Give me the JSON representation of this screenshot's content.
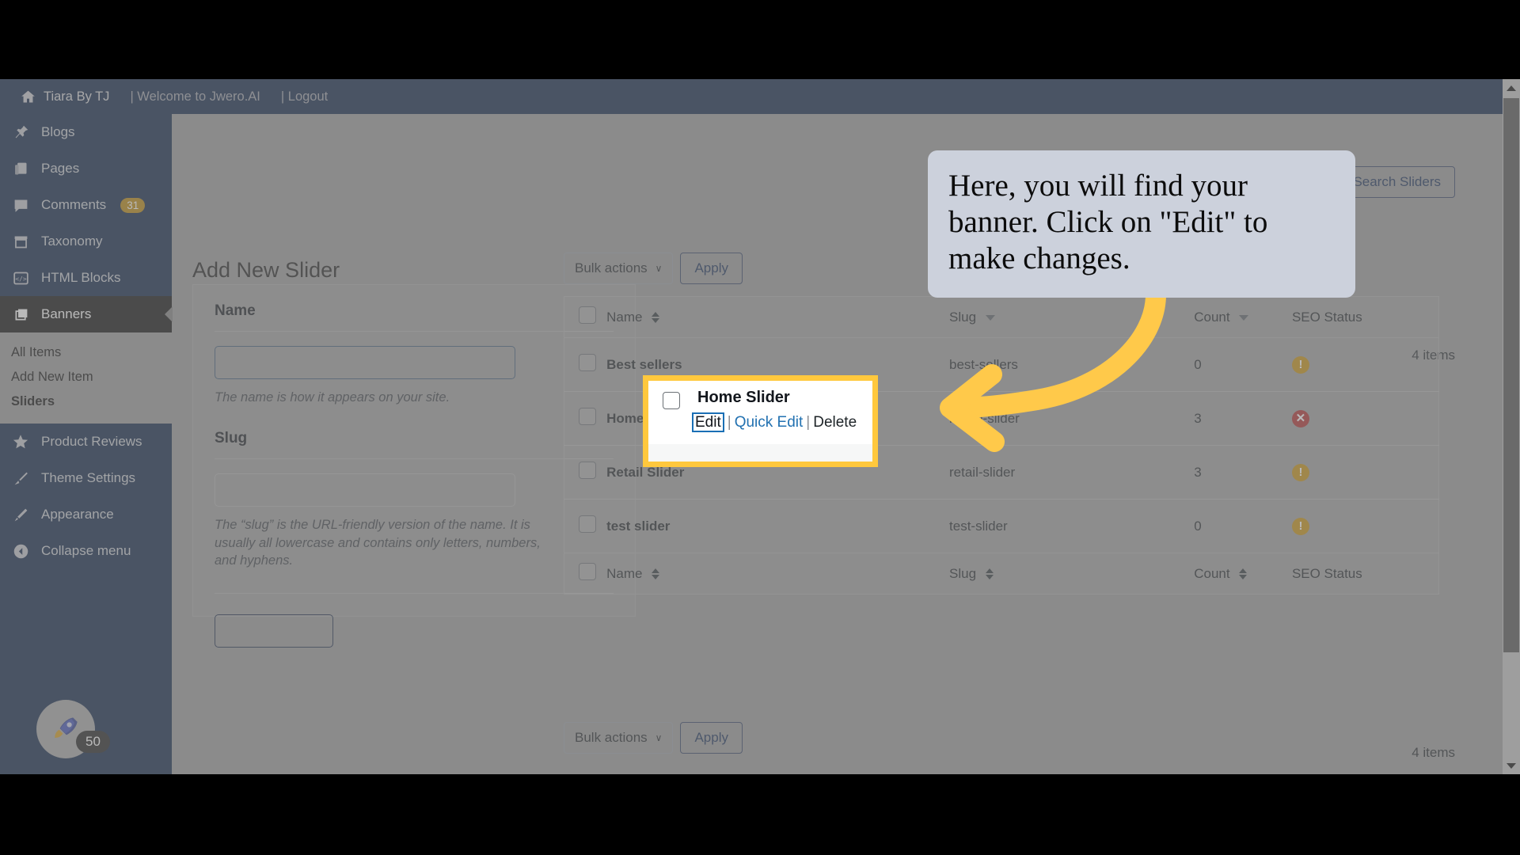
{
  "adminbar": {
    "home_icon": "home-icon",
    "site_name": "Tiara By TJ",
    "welcome": "| Welcome to Jwero.AI",
    "logout": "| Logout"
  },
  "sidebar": {
    "items": [
      {
        "label": "Blogs",
        "icon": "pin-icon",
        "badge": ""
      },
      {
        "label": "Pages",
        "icon": "pages-icon",
        "badge": ""
      },
      {
        "label": "Comments",
        "icon": "comment-icon",
        "badge": "31"
      },
      {
        "label": "Taxonomy",
        "icon": "archive-icon",
        "badge": ""
      },
      {
        "label": "HTML Blocks",
        "icon": "code-icon",
        "badge": ""
      },
      {
        "label": "Banners",
        "icon": "layers-icon",
        "badge": ""
      },
      {
        "label": "Product Reviews",
        "icon": "star-icon",
        "badge": ""
      },
      {
        "label": "Theme Settings",
        "icon": "brush-icon",
        "badge": ""
      },
      {
        "label": "Appearance",
        "icon": "roller-icon",
        "badge": ""
      },
      {
        "label": "Collapse menu",
        "icon": "collapse-icon",
        "badge": ""
      }
    ],
    "submenu": [
      {
        "label": "All Items",
        "current": false
      },
      {
        "label": "Add New Item",
        "current": false
      },
      {
        "label": "Sliders",
        "current": true
      }
    ],
    "rocket": {
      "icon": "rocket-icon",
      "badge": "50"
    }
  },
  "content": {
    "search_button": "Search Sliders",
    "page_title": "Add New Slider",
    "form": {
      "name_label": "Name",
      "name_value": "",
      "name_help": "The name is how it appears on your site.",
      "slug_label": "Slug",
      "slug_value": "",
      "slug_help": "The “slug” is the URL-friendly version of the name. It is usually all lowercase and contains only letters, numbers, and hyphens.",
      "submit_label": ""
    },
    "tablenav": {
      "bulk_actions": "Bulk actions",
      "caret": "∨",
      "apply": "Apply",
      "items_top": "4 items",
      "items_bottom": "4 items"
    },
    "table": {
      "columns": [
        "Name",
        "Slug",
        "Count",
        "SEO Status"
      ],
      "rows": [
        {
          "name": "Best sellers",
          "slug": "best-sellers",
          "count": "0",
          "seo": "warning"
        },
        {
          "name": "Home Slider",
          "slug": "home-slider",
          "count": "3",
          "seo": "error"
        },
        {
          "name": "Retail Slider",
          "slug": "retail-slider",
          "count": "3",
          "seo": "warning"
        },
        {
          "name": "test slider",
          "slug": "test-slider",
          "count": "0",
          "seo": "warning"
        }
      ]
    }
  },
  "annotations": {
    "callout_text": "Here, you will find your banner. Click on \"Edit\" to make changes.",
    "arrow": "curved-arrow-left",
    "highlight": {
      "name": "Home Slider",
      "edit": "Edit",
      "quick_edit": "Quick Edit",
      "delete": "Delete",
      "sep": "|"
    }
  },
  "colors": {
    "admin_blue": "#0a1f44",
    "highlight_yellow": "#ffc83d",
    "link_blue": "#2271b1",
    "seo_warning": "#c8900c",
    "seo_error": "#b02a2a",
    "callout_bg": "#ccd1dc"
  }
}
